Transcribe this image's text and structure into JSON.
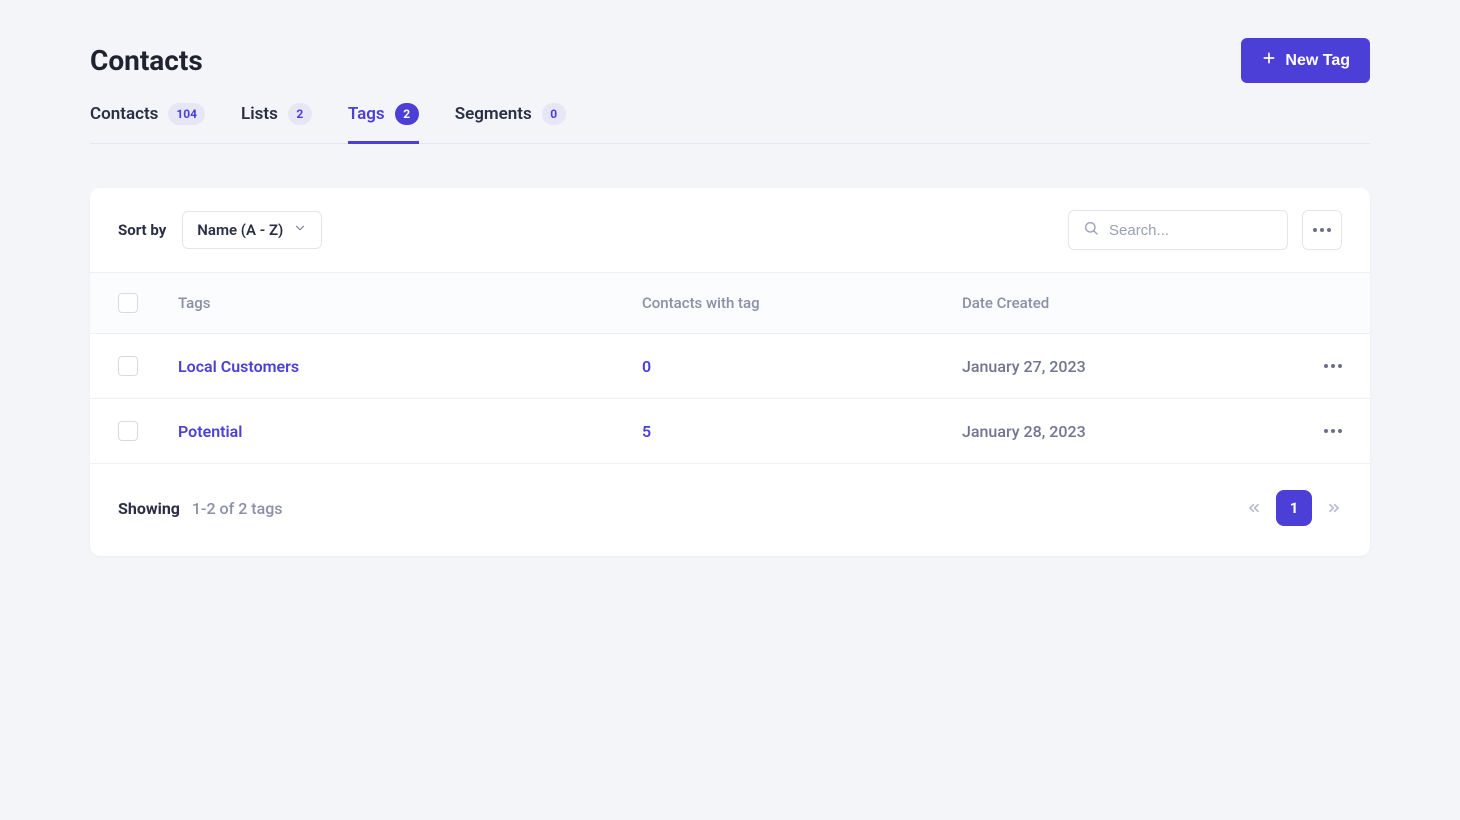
{
  "header": {
    "title": "Contacts",
    "new_button_label": "New Tag"
  },
  "tabs": [
    {
      "label": "Contacts",
      "count": "104",
      "active": false
    },
    {
      "label": "Lists",
      "count": "2",
      "active": false
    },
    {
      "label": "Tags",
      "count": "2",
      "active": true
    },
    {
      "label": "Segments",
      "count": "0",
      "active": false
    }
  ],
  "sort": {
    "label": "Sort by",
    "selected": "Name (A - Z)"
  },
  "search": {
    "placeholder": "Search..."
  },
  "columns": {
    "tags": "Tags",
    "contacts": "Contacts with tag",
    "date": "Date Created"
  },
  "rows": [
    {
      "name": "Local Customers",
      "count": "0",
      "date": "January 27, 2023"
    },
    {
      "name": "Potential",
      "count": "5",
      "date": "January 28, 2023"
    }
  ],
  "footer": {
    "showing_label": "Showing",
    "range_text": "1-2 of 2 tags"
  },
  "pagination": {
    "current": "1"
  }
}
